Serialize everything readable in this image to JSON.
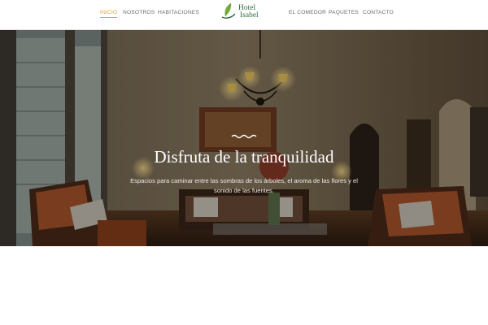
{
  "nav": {
    "left_items": [
      {
        "label": "INICIO",
        "active": true
      },
      {
        "label": "NOSOTROS",
        "active": false
      },
      {
        "label": "HABITACIONES",
        "active": false
      }
    ],
    "right_items": [
      {
        "label": "EL COMEDOR",
        "active": false
      },
      {
        "label": "PAQUETES",
        "active": false
      },
      {
        "label": "CONTACTO",
        "active": false
      }
    ],
    "active_color": "#e0a23a",
    "text_color": "#6a6a6a"
  },
  "logo": {
    "line1": "Hotel",
    "line2": "Isabel",
    "icon": "leaf-icon",
    "color": "#2f6b3a",
    "leaf_color": "#7cb342"
  },
  "hero": {
    "divider_icon": "wave-icon",
    "title": "Disfruta de la tranquilidad",
    "subtitle": "Espacios para caminar entre las sombras de los árboles, el aroma de las flores y el sonido de las fuentes."
  }
}
